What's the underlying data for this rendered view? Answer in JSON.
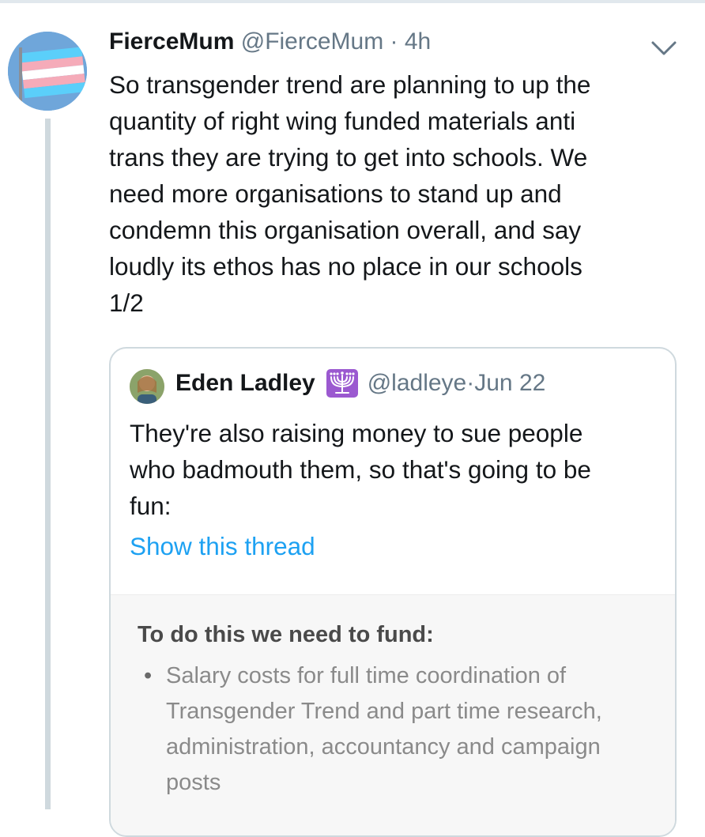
{
  "tweet": {
    "display_name": "FierceMum",
    "handle": "@FierceMum",
    "separator": "·",
    "time": "4h",
    "text": "So transgender trend are planning to up the\nquantity of right wing funded materials anti\ntrans they are trying to get into schools. We\nneed more organisations to stand up and\ncondemn this organisation overall, and say\nloudly its ethos has no place in our schools\n1/2",
    "avatar_icon": "trans-flag-avatar",
    "menu_icon": "chevron-down-icon"
  },
  "quoted_tweet": {
    "display_name": "Eden Ladley",
    "emoji_icon": "menorah-icon",
    "handle": "@ladleye",
    "separator": "·",
    "time": "Jun 22",
    "text": "They're also raising money to sue people\nwho badmouth them, so that's going to be\nfun:",
    "show_thread_label": "Show this thread",
    "image": {
      "heading": "To do this we need to fund:",
      "bullet": "Salary costs for full time coordination of\nTransgender Trend and part time research,\nadministration, accountancy and campaign\nposts"
    }
  },
  "colors": {
    "link": "#1da1f2",
    "secondary_text": "#657786",
    "border": "#cfd9de"
  }
}
